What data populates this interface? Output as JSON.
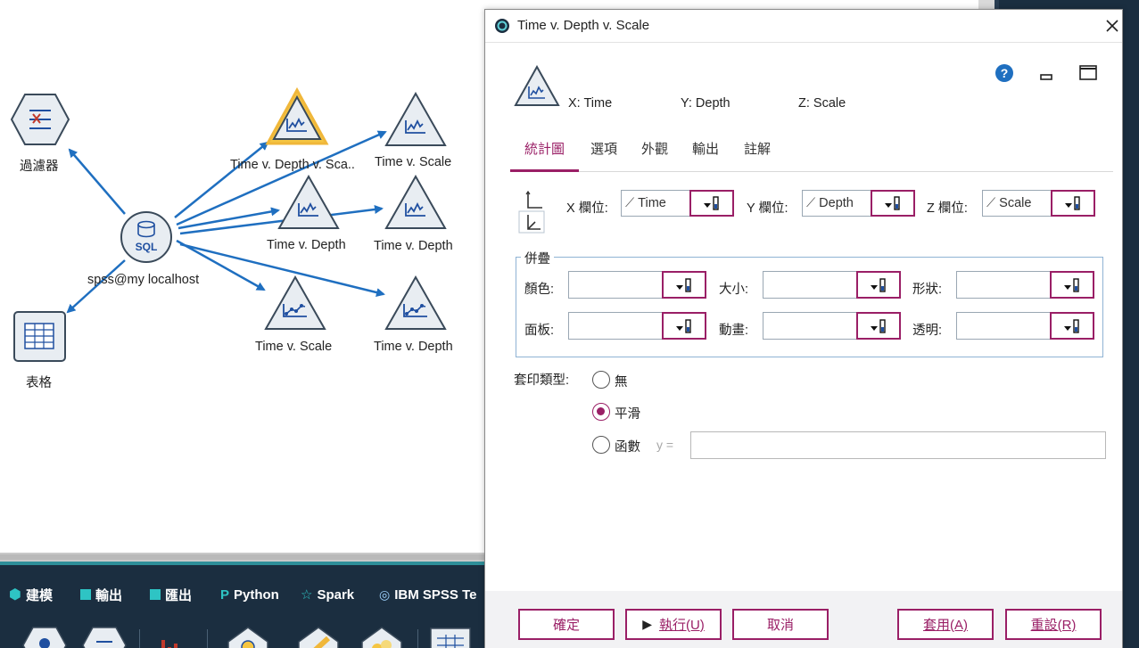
{
  "canvas": {
    "nodes": {
      "filter": "過濾器",
      "table": "表格",
      "source": "spss@my localhost",
      "plot_selected": "Time v. Depth v. Sca..",
      "plot_a": "Time v. Scale",
      "plot_b": "Time v. Depth",
      "plot_c": "Time v. Depth",
      "mplot_a": "Time v. Scale",
      "mplot_b": "Time v. Depth"
    },
    "source_badge": "SQL"
  },
  "palette": {
    "tabs": [
      "建模",
      "輸出",
      "匯出",
      "Python",
      "Spark",
      "IBM SPSS Te"
    ]
  },
  "dialog": {
    "title": "Time v. Depth v. Scale",
    "summary": {
      "x": "X: Time",
      "y": "Y: Depth",
      "z": "Z: Scale"
    },
    "tabs": [
      "統計圖",
      "選項",
      "外觀",
      "輸出",
      "註解"
    ],
    "active_tab": "統計圖",
    "fields": {
      "x_label": "X 欄位:",
      "x_value": "Time",
      "y_label": "Y 欄位:",
      "y_value": "Depth",
      "z_label": "Z 欄位:",
      "z_value": "Scale"
    },
    "overlay": {
      "legend": "併疊",
      "color_label": "顏色:",
      "size_label": "大小:",
      "shape_label": "形狀:",
      "panel_label": "面板:",
      "animation_label": "動畫:",
      "transparency_label": "透明:"
    },
    "overlay_type": {
      "label": "套印類型:",
      "options": [
        "無",
        "平滑",
        "函數"
      ],
      "selected": "平滑",
      "function_prefix": "y =",
      "function_value": ""
    },
    "buttons": {
      "ok": "確定",
      "run": "執行(U)",
      "cancel": "取消",
      "apply": "套用(A)",
      "reset": "重設(R)"
    },
    "colors": {
      "accent": "#9a1f66",
      "link": "#1f6fc0"
    }
  }
}
